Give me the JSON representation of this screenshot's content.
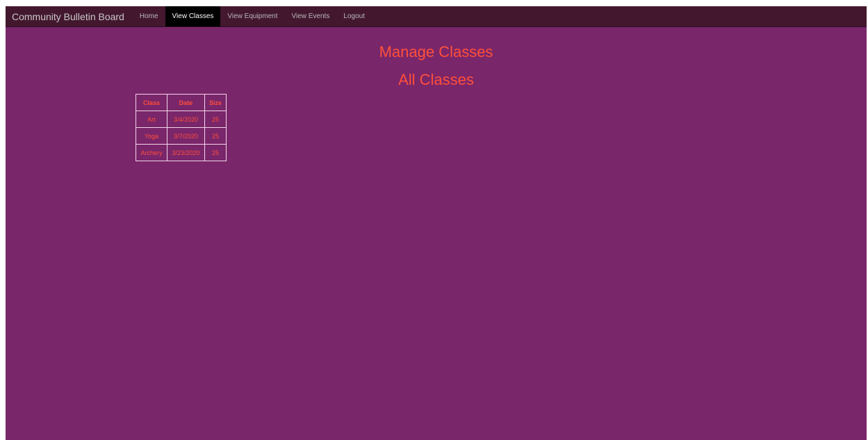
{
  "header": {
    "brand": "Community Bulletin Board",
    "nav": [
      {
        "label": "Home",
        "active": false
      },
      {
        "label": "View Classes",
        "active": true
      },
      {
        "label": "View Equipment",
        "active": false
      },
      {
        "label": "View Events",
        "active": false
      },
      {
        "label": "Logout",
        "active": false
      }
    ]
  },
  "main": {
    "title": "Manage Classes",
    "subtitle": "All Classes",
    "table": {
      "headers": [
        "Class",
        "Date",
        "Size"
      ],
      "rows": [
        [
          "Art",
          "3/4/2020",
          "25"
        ],
        [
          "Yoga",
          "3/7/2020",
          "25"
        ],
        [
          "Archery",
          "3/23/2020",
          "25"
        ]
      ]
    }
  },
  "colors": {
    "page_background": "#7a266a",
    "navbar_background": "#43182f",
    "active_nav_background": "#000000",
    "accent_text": "#ff4f3a",
    "table_border": "#f3d6eb"
  }
}
